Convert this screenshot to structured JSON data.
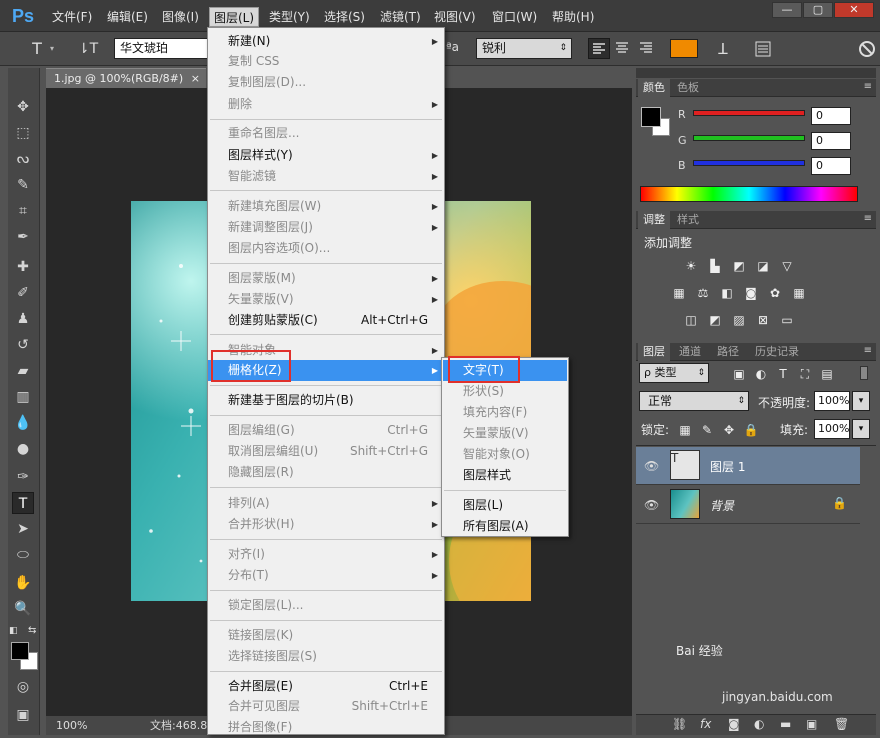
{
  "app": {
    "logo": "Ps"
  },
  "menubar": {
    "items": [
      "文件(F)",
      "编辑(E)",
      "图像(I)",
      "图层(L)",
      "类型(Y)",
      "选择(S)",
      "滤镜(T)",
      "视图(V)",
      "窗口(W)",
      "帮助(H)"
    ],
    "active": "图层(L)"
  },
  "window_controls": {
    "minimize": "—",
    "restore": "▢",
    "close": "✕"
  },
  "options_bar": {
    "font_family": "华文琥珀",
    "antialias_label": "ªa",
    "antialias_value": "锐利",
    "text_color": "#f08a00"
  },
  "document": {
    "tab_title": "1.jpg @ 100%(RGB/8#)",
    "tab_close": "×",
    "zoom": "100%",
    "doc_info": "文档:468.8"
  },
  "layer_menu": {
    "items": [
      {
        "label": "新建(N)",
        "shortcut": "",
        "disabled": false,
        "submenu": true
      },
      {
        "label": "复制 CSS",
        "shortcut": "",
        "disabled": true,
        "submenu": false
      },
      {
        "label": "复制图层(D)...",
        "shortcut": "",
        "disabled": true,
        "submenu": false
      },
      {
        "label": "删除",
        "shortcut": "",
        "disabled": true,
        "submenu": true
      },
      {
        "label": "重命名图层...",
        "shortcut": "",
        "disabled": true,
        "submenu": false
      },
      {
        "label": "图层样式(Y)",
        "shortcut": "",
        "disabled": false,
        "submenu": true
      },
      {
        "label": "智能滤镜",
        "shortcut": "",
        "disabled": true,
        "submenu": true
      },
      {
        "label": "新建填充图层(W)",
        "shortcut": "",
        "disabled": true,
        "submenu": true
      },
      {
        "label": "新建调整图层(J)",
        "shortcut": "",
        "disabled": true,
        "submenu": true
      },
      {
        "label": "图层内容选项(O)...",
        "shortcut": "",
        "disabled": true,
        "submenu": false
      },
      {
        "label": "图层蒙版(M)",
        "shortcut": "",
        "disabled": true,
        "submenu": true
      },
      {
        "label": "矢量蒙版(V)",
        "shortcut": "",
        "disabled": true,
        "submenu": true
      },
      {
        "label": "创建剪贴蒙版(C)",
        "shortcut": "Alt+Ctrl+G",
        "disabled": false,
        "submenu": false
      },
      {
        "label": "智能对象",
        "shortcut": "",
        "disabled": true,
        "submenu": true
      },
      {
        "label": "栅格化(Z)",
        "shortcut": "",
        "disabled": false,
        "submenu": true
      },
      {
        "label": "新建基于图层的切片(B)",
        "shortcut": "",
        "disabled": false,
        "submenu": false
      },
      {
        "label": "图层编组(G)",
        "shortcut": "Ctrl+G",
        "disabled": true,
        "submenu": false
      },
      {
        "label": "取消图层编组(U)",
        "shortcut": "Shift+Ctrl+G",
        "disabled": true,
        "submenu": false
      },
      {
        "label": "隐藏图层(R)",
        "shortcut": "",
        "disabled": true,
        "submenu": false
      },
      {
        "label": "排列(A)",
        "shortcut": "",
        "disabled": true,
        "submenu": true
      },
      {
        "label": "合并形状(H)",
        "shortcut": "",
        "disabled": true,
        "submenu": true
      },
      {
        "label": "对齐(I)",
        "shortcut": "",
        "disabled": true,
        "submenu": true
      },
      {
        "label": "分布(T)",
        "shortcut": "",
        "disabled": true,
        "submenu": true
      },
      {
        "label": "锁定图层(L)...",
        "shortcut": "",
        "disabled": true,
        "submenu": false
      },
      {
        "label": "链接图层(K)",
        "shortcut": "",
        "disabled": true,
        "submenu": false
      },
      {
        "label": "选择链接图层(S)",
        "shortcut": "",
        "disabled": true,
        "submenu": false
      },
      {
        "label": "合并图层(E)",
        "shortcut": "Ctrl+E",
        "disabled": false,
        "submenu": false
      },
      {
        "label": "合并可见图层",
        "shortcut": "Shift+Ctrl+E",
        "disabled": true,
        "submenu": false
      },
      {
        "label": "拼合图像(F)",
        "shortcut": "",
        "disabled": true,
        "submenu": false
      }
    ],
    "highlighted": "栅格化(Z)"
  },
  "rasterize_submenu": {
    "items": [
      {
        "label": "文字(T)",
        "disabled": false
      },
      {
        "label": "形状(S)",
        "disabled": true
      },
      {
        "label": "填充内容(F)",
        "disabled": true
      },
      {
        "label": "矢量蒙版(V)",
        "disabled": true
      },
      {
        "label": "智能对象(O)",
        "disabled": true
      },
      {
        "label": "图层样式",
        "disabled": false
      },
      {
        "label": "图层(L)",
        "disabled": false
      },
      {
        "label": "所有图层(A)",
        "disabled": false
      }
    ],
    "highlighted": "文字(T)"
  },
  "color_panel": {
    "tabs": [
      "颜色",
      "色板"
    ],
    "channels": [
      {
        "name": "R",
        "value": "0",
        "color": "#e02020"
      },
      {
        "name": "G",
        "value": "0",
        "color": "#20c020"
      },
      {
        "name": "B",
        "value": "0",
        "color": "#2030e0"
      }
    ],
    "foreground": "#000000",
    "background": "#ffffff"
  },
  "adjust_panel": {
    "tabs": [
      "调整",
      "样式"
    ],
    "title": "添加调整"
  },
  "layers_panel": {
    "tabs": [
      "图层",
      "通道",
      "路径",
      "历史记录"
    ],
    "filter_kind": "ρ 类型",
    "blend_mode": "正常",
    "opacity_label": "不透明度:",
    "opacity": "100%",
    "lock_label": "锁定:",
    "fill_label": "填充:",
    "fill": "100%",
    "layers": [
      {
        "name": "图层 1",
        "type": "text",
        "thumb": "T",
        "selected": true
      },
      {
        "name": "背景",
        "type": "image",
        "locked": true,
        "selected": false
      }
    ],
    "footer_icons": [
      "link-icon",
      "fx-icon",
      "mask-icon",
      "adjustment-icon",
      "folder-icon",
      "new-layer-icon",
      "trash-icon"
    ],
    "fx_label": "fx"
  },
  "watermark": {
    "text": "Bai 经验",
    "sub": "jingyan.baidu.com"
  }
}
